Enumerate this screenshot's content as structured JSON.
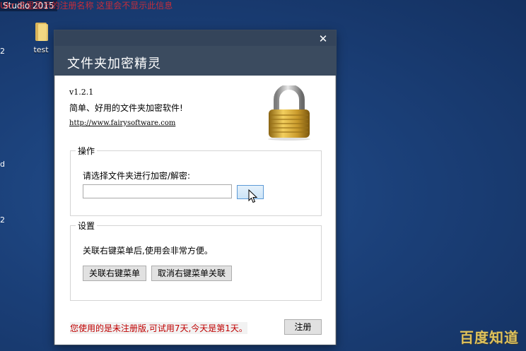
{
  "desktop": {
    "top_text": "Studio 2015",
    "warning_text": "Ukr 这里显示的注册名称 这里会不显示此信息",
    "edge_labels": [
      "2",
      "d",
      "2"
    ],
    "icon_label": "test"
  },
  "window": {
    "title": "文件夹加密精灵",
    "close_glyph": "✕"
  },
  "about": {
    "version": "v1.2.1",
    "description": "简单、好用的文件夹加密软件!",
    "url": "http://www.fairysoftware.com"
  },
  "operation": {
    "legend": "操作",
    "prompt": "请选择文件夹进行加密/解密:",
    "path_value": "",
    "browse_label": ".."
  },
  "settings": {
    "legend": "设置",
    "text": "关联右键菜单后,使用会非常方便。",
    "associate_label": "关联右键菜单",
    "unassociate_label": "取消右键菜单关联"
  },
  "footer": {
    "trial_text": "您使用的是未注册版,可试用7天,今天是第1天。",
    "register_label": "注册"
  },
  "watermark": "百度知道"
}
